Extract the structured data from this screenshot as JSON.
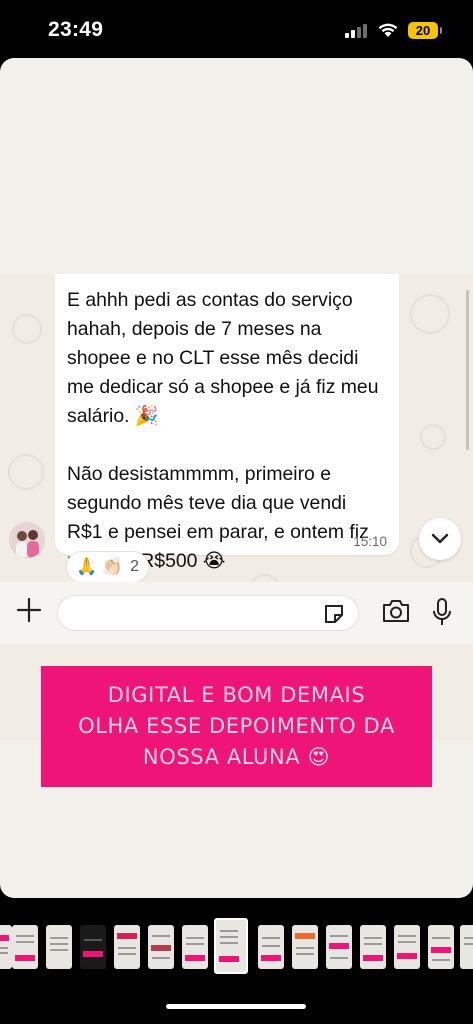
{
  "status_bar": {
    "time": "23:49",
    "battery": "20",
    "icons": [
      "signal-icon",
      "wifi-icon",
      "battery-icon"
    ]
  },
  "chat": {
    "message_text": "E ahhh pedi as contas do serviço hahah, depois de 7 meses na shopee e no CLT esse mês decidi me dedicar só a shopee e já fiz meu salário. 🎉\n\nNão desistammmm, primeiro e segundo mês teve dia que vendi R$1 e pensei em parar, e ontem fiz mais de R$500 😭",
    "message_time": "15:10",
    "reactions": {
      "emojis": "🙏 👏🏻",
      "count": "2"
    },
    "composer": {
      "input_value": "",
      "icons": [
        "plus-icon",
        "sticker-icon",
        "camera-icon",
        "microphone-icon"
      ]
    }
  },
  "caption": {
    "lines": [
      "DIGITAL E BOM DEMAIS",
      "OLHA ESSE DEPOIMENTO DA",
      "NOSSA ALUNA 😍"
    ],
    "background": "#ef1478",
    "text_color": "#fbd3e4"
  },
  "thumbnails": {
    "count": 14,
    "active_index": 7
  }
}
